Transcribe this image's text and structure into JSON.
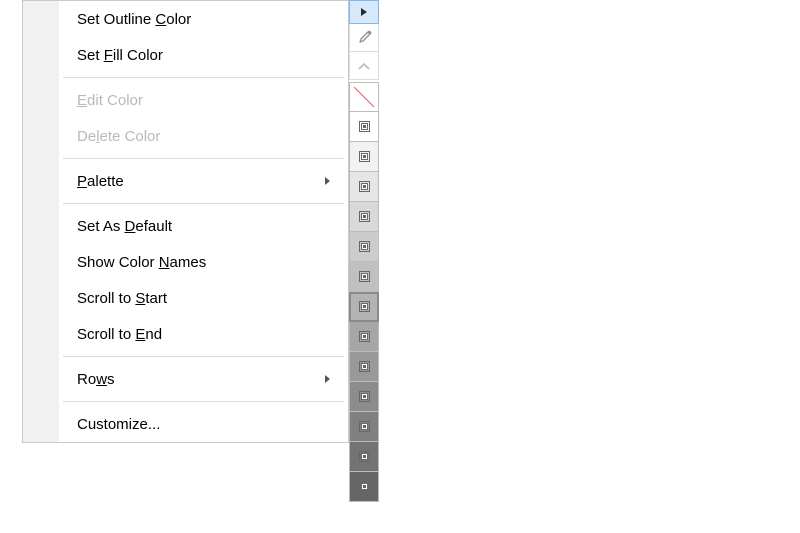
{
  "menu": {
    "items": [
      {
        "id": "set-outline-color",
        "pre": "Set Outline ",
        "mn": "C",
        "post": "olor",
        "enabled": true,
        "submenu": false
      },
      {
        "id": "set-fill-color",
        "pre": "Set ",
        "mn": "F",
        "post": "ill Color",
        "enabled": true,
        "submenu": false
      },
      "sep",
      {
        "id": "edit-color",
        "pre": "",
        "mn": "E",
        "post": "dit Color",
        "enabled": false,
        "submenu": false
      },
      {
        "id": "delete-color",
        "pre": "De",
        "mn": "l",
        "post": "ete Color",
        "enabled": false,
        "submenu": false
      },
      "sep",
      {
        "id": "palette",
        "pre": "",
        "mn": "P",
        "post": "alette",
        "enabled": true,
        "submenu": true
      },
      "sep",
      {
        "id": "set-as-default",
        "pre": "Set As ",
        "mn": "D",
        "post": "efault",
        "enabled": true,
        "submenu": false
      },
      {
        "id": "show-color-names",
        "pre": "Show Color ",
        "mn": "N",
        "post": "ames",
        "enabled": true,
        "submenu": false
      },
      {
        "id": "scroll-to-start",
        "pre": "Scroll to ",
        "mn": "S",
        "post": "tart",
        "enabled": true,
        "submenu": false
      },
      {
        "id": "scroll-to-end",
        "pre": "Scroll to ",
        "mn": "E",
        "post": "nd",
        "enabled": true,
        "submenu": false
      },
      "sep",
      {
        "id": "rows",
        "pre": "Ro",
        "mn": "w",
        "post": "s",
        "enabled": true,
        "submenu": true
      },
      "sep",
      {
        "id": "customize",
        "pre": "Customize...",
        "mn": "",
        "post": "",
        "enabled": true,
        "submenu": false
      }
    ]
  },
  "palette": {
    "swatches": [
      {
        "type": "none"
      },
      {
        "color": "#ffffff"
      },
      {
        "color": "#f2f2f2"
      },
      {
        "color": "#e6e6e6"
      },
      {
        "color": "#d9d9d9"
      },
      {
        "color": "#cccccc"
      },
      {
        "color": "#c0c0c0"
      },
      {
        "color": "#b3b3b3",
        "selected": true
      },
      {
        "color": "#a6a6a6"
      },
      {
        "color": "#999999"
      },
      {
        "color": "#8c8c8c"
      },
      {
        "color": "#808080"
      },
      {
        "color": "#737373"
      },
      {
        "color": "#666666"
      }
    ]
  }
}
